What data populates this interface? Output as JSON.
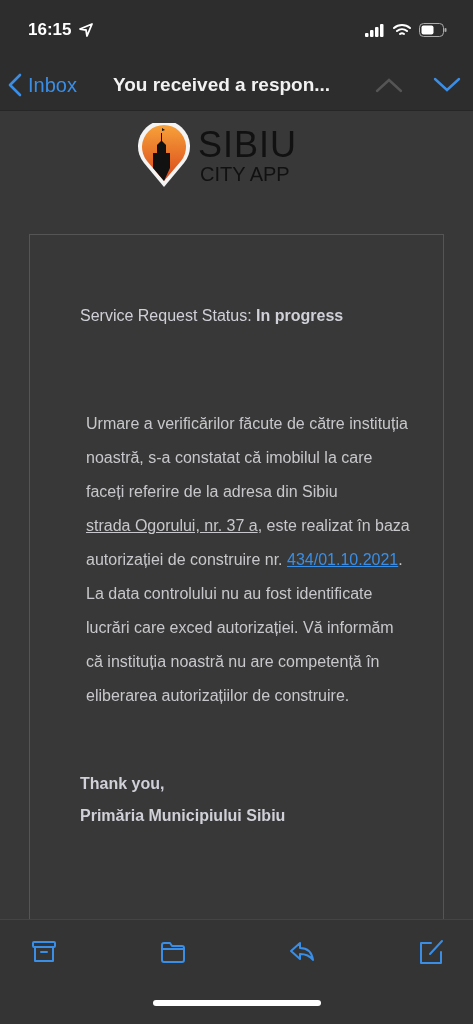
{
  "status_bar": {
    "time": "16:15"
  },
  "nav": {
    "back_label": "Inbox",
    "title": "You received a respon...",
    "previous_disabled": true,
    "next_disabled": false
  },
  "logo": {
    "name": "SIBIU",
    "subtitle": "CITY APP"
  },
  "email": {
    "status_line": "Service Request Status: **In progress**",
    "body": [
      {
        "kind": "text",
        "text": "Urmare a verificărilor făcute de către instituția noastră, s-a constatat că imobilul la care faceți referire de la adresa din Sibiu "
      },
      {
        "kind": "link",
        "text": "strada Ogorului, nr. 37 a"
      },
      {
        "kind": "text",
        "text": ", este realizat în baza autorizației de construire nr. "
      },
      {
        "kind": "link",
        "text": "434/01.10.2021"
      },
      {
        "kind": "text",
        "text": ". La data controlului nu au fost identificate lucrări care exced autorizației. Vă informăm că instituția noastră nu are competență în eliberarea autorizațiilor de construire."
      }
    ],
    "closing": "Thank you,",
    "signature": "Primăria Municipiului Sibiu"
  },
  "toolbar": [
    {
      "kind": "archive"
    },
    {
      "kind": "folder"
    },
    {
      "kind": "reply"
    },
    {
      "kind": "compose"
    }
  ]
}
